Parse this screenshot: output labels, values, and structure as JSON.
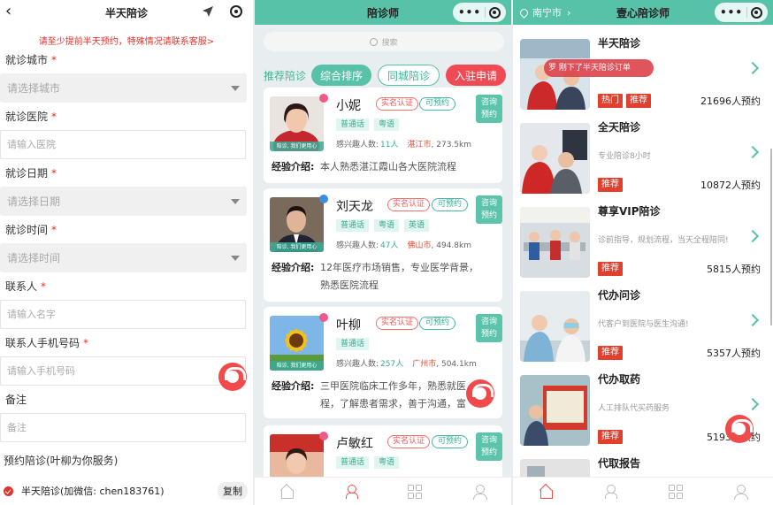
{
  "form_page": {
    "title": "半天陪诊",
    "notice": "请至少提前半天预约，特殊情况请联系客服>",
    "fields": [
      {
        "label": "就诊城市",
        "required": true,
        "type": "select",
        "placeholder": "请选择城市"
      },
      {
        "label": "就诊医院",
        "required": true,
        "type": "input",
        "placeholder": "请输入医院"
      },
      {
        "label": "就诊日期",
        "required": true,
        "type": "select",
        "placeholder": "请选择日期"
      },
      {
        "label": "就诊时间",
        "required": true,
        "type": "select",
        "placeholder": "请选择时间"
      },
      {
        "label": "联系人",
        "required": true,
        "type": "input",
        "placeholder": "请输入名字"
      },
      {
        "label": "联系人手机号码",
        "required": true,
        "type": "input",
        "placeholder": "请输入手机号码"
      },
      {
        "label": "备注",
        "required": false,
        "type": "input",
        "placeholder": "备注"
      }
    ],
    "required_mark": "*",
    "service_section_title": "预约陪诊(叶柳为你服务)",
    "service_option": "半天陪诊(加微信: chen183761)",
    "copy_label": "复制"
  },
  "escort_page": {
    "title": "陪诊师",
    "search_placeholder": "搜索",
    "tab_label": "推荐陪诊",
    "tabs": [
      "综合排序",
      "同城陪诊",
      "入驻申请"
    ],
    "verify_label": "实名认证",
    "available_label": "可预约",
    "consult_label_1": "咨询",
    "consult_label_2": "预约",
    "interest_label": "感兴趣人数:",
    "exp_label": "经验介绍:",
    "photo_caption": "陪诊, 我们更用心",
    "escorts": [
      {
        "name": "小妮",
        "langs": [
          "普通话",
          "粤语"
        ],
        "interest": "11人",
        "city": "湛江市",
        "distance": "273.5km",
        "intro_1": "本人熟悉湛江霞山各大医院流程",
        "intro_2": "",
        "pin_color": "#ef5a8a"
      },
      {
        "name": "刘天龙",
        "langs": [
          "普通话",
          "粤语",
          "英语"
        ],
        "interest": "47人",
        "city": "佛山市",
        "distance": "494.8km",
        "intro_1": "12年医疗市场销售，专业医学背景，",
        "intro_2": "熟悉医院流程",
        "pin_color": "#3a8fe0"
      },
      {
        "name": "叶柳",
        "langs": [
          "普通话"
        ],
        "interest": "257人",
        "city": "广州市",
        "distance": "504.1km",
        "intro_1": "三甲医院临床工作多年，熟悉就医",
        "intro_2": "程，了解患者需求，善于沟通，富",
        "pin_color": "#ef5a8a"
      },
      {
        "name": "卢敏红",
        "langs": [
          "普通话",
          "粤语"
        ],
        "interest": "",
        "city": "",
        "distance": "",
        "intro_1": "",
        "intro_2": "",
        "pin_color": "#ef5a8a"
      }
    ]
  },
  "service_page": {
    "location": "南宁市",
    "title": "壹心陪诊师",
    "toast": "罗 刚下了半天陪诊订单",
    "items": [
      {
        "title": "半天陪诊",
        "desc": "",
        "tags": [
          "热门",
          "推荐"
        ],
        "count": "21696人预约"
      },
      {
        "title": "全天陪诊",
        "desc": "专业陪诊8小时",
        "tags": [
          "推荐"
        ],
        "count": "10872人预约"
      },
      {
        "title": "尊享VIP陪诊",
        "desc": "诊前指导，规划流程，当天全程陪同!",
        "tags": [
          "推荐"
        ],
        "count": "5815人预约"
      },
      {
        "title": "代办问诊",
        "desc": "代客户到医院与医生沟通!",
        "tags": [
          "推荐"
        ],
        "count": "5357人预约"
      },
      {
        "title": "代办取药",
        "desc": "人工排队代买药服务",
        "tags": [
          "推荐"
        ],
        "count": "5193人预约"
      },
      {
        "title": "代取报告",
        "desc": "",
        "tags": [],
        "count": ""
      }
    ]
  },
  "capsule": {
    "dots": "•••"
  },
  "colors": {
    "teal": "#58c2a8",
    "red": "#e0342d",
    "accent_red": "#ef4b55"
  }
}
